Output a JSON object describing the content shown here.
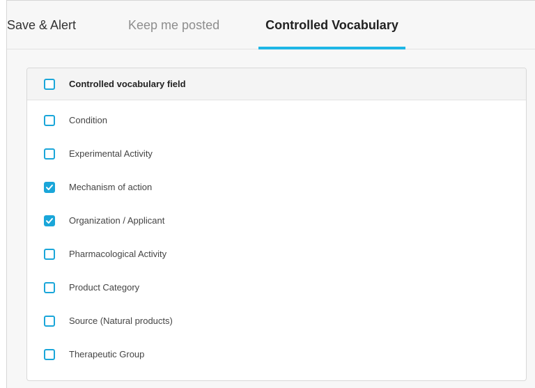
{
  "tabs": [
    {
      "label": "Save & Alert",
      "active": false
    },
    {
      "label": "Keep me posted",
      "active": false
    },
    {
      "label": "Controlled Vocabulary",
      "active": true
    }
  ],
  "colors": {
    "accent": "#1eb6e6",
    "checkbox": "#1aa6d9"
  },
  "panel": {
    "header_label": "Controlled vocabulary field",
    "header_checked": false,
    "items": [
      {
        "label": "Condition",
        "checked": false
      },
      {
        "label": "Experimental Activity",
        "checked": false
      },
      {
        "label": "Mechanism of action",
        "checked": true
      },
      {
        "label": "Organization / Applicant",
        "checked": true
      },
      {
        "label": "Pharmacological Activity",
        "checked": false
      },
      {
        "label": "Product Category",
        "checked": false
      },
      {
        "label": "Source (Natural products)",
        "checked": false
      },
      {
        "label": "Therapeutic Group",
        "checked": false
      }
    ]
  }
}
